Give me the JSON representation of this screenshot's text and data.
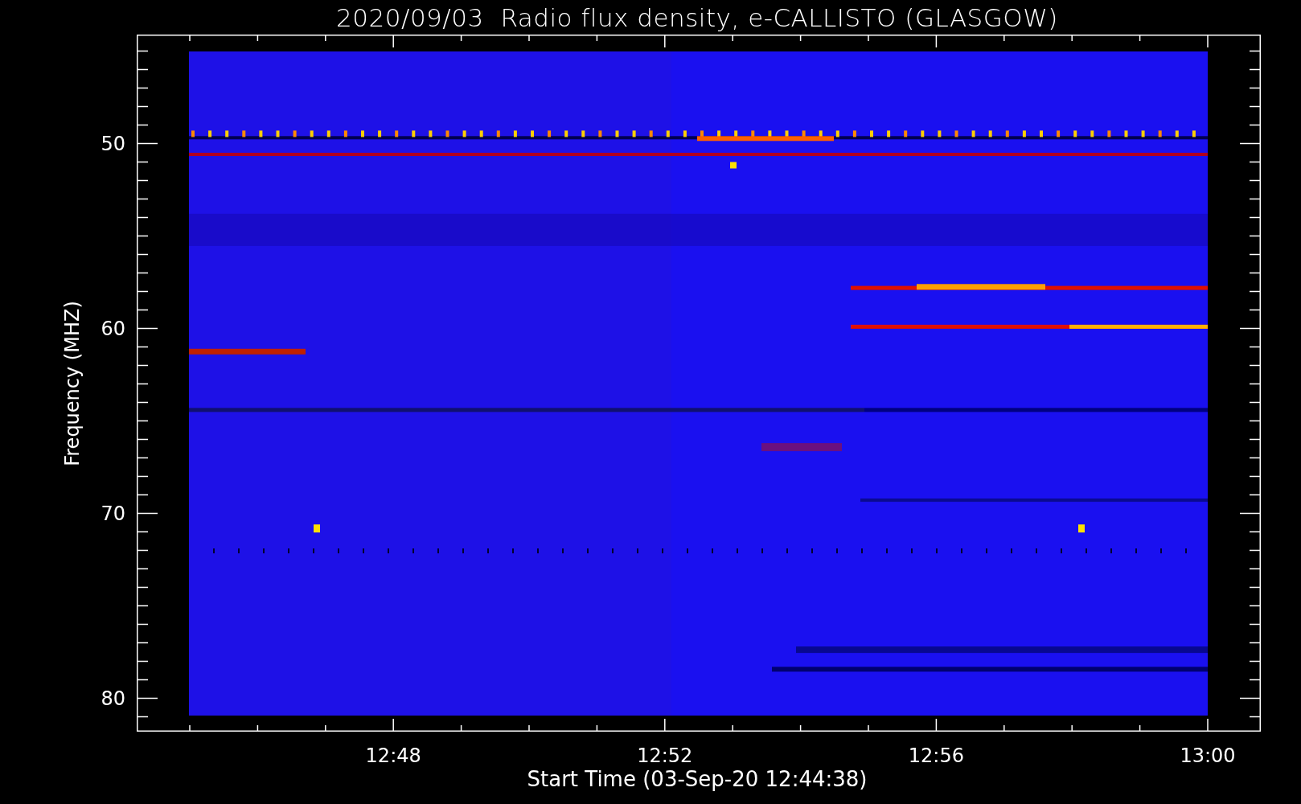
{
  "title": "2020/09/03  Radio flux density, e-CALLISTO (GLASGOW)",
  "y_axis": {
    "label": "Frequency (MHZ)",
    "ticks": [
      "50",
      "60",
      "70",
      "80"
    ]
  },
  "x_axis": {
    "label": "Start Time (03-Sep-20 12:44:38)",
    "ticks": [
      "12:48",
      "12:52",
      "12:56",
      "13:00"
    ]
  }
}
